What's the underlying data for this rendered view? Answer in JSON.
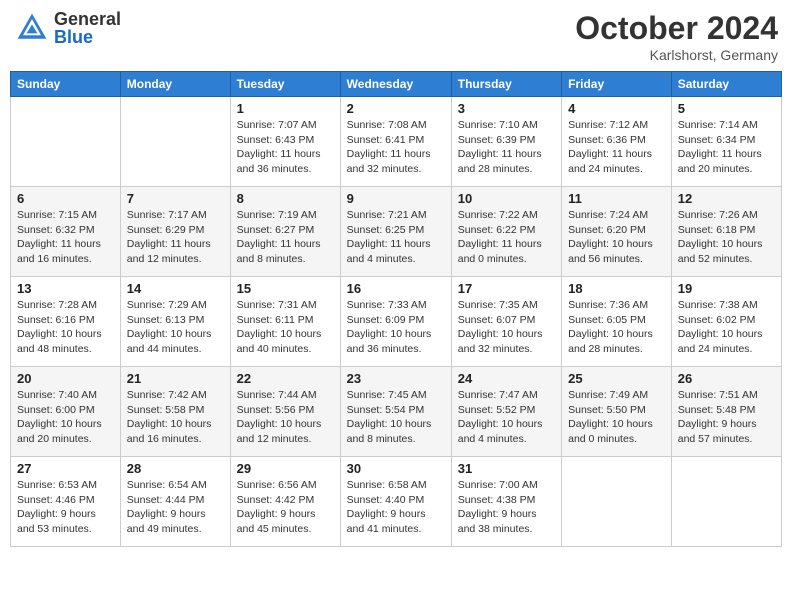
{
  "header": {
    "logo_general": "General",
    "logo_blue": "Blue",
    "month_title": "October 2024",
    "location": "Karlshorst, Germany"
  },
  "days_of_week": [
    "Sunday",
    "Monday",
    "Tuesday",
    "Wednesday",
    "Thursday",
    "Friday",
    "Saturday"
  ],
  "weeks": [
    [
      {
        "day": "",
        "info": ""
      },
      {
        "day": "",
        "info": ""
      },
      {
        "day": "1",
        "info": "Sunrise: 7:07 AM\nSunset: 6:43 PM\nDaylight: 11 hours and 36 minutes."
      },
      {
        "day": "2",
        "info": "Sunrise: 7:08 AM\nSunset: 6:41 PM\nDaylight: 11 hours and 32 minutes."
      },
      {
        "day": "3",
        "info": "Sunrise: 7:10 AM\nSunset: 6:39 PM\nDaylight: 11 hours and 28 minutes."
      },
      {
        "day": "4",
        "info": "Sunrise: 7:12 AM\nSunset: 6:36 PM\nDaylight: 11 hours and 24 minutes."
      },
      {
        "day": "5",
        "info": "Sunrise: 7:14 AM\nSunset: 6:34 PM\nDaylight: 11 hours and 20 minutes."
      }
    ],
    [
      {
        "day": "6",
        "info": "Sunrise: 7:15 AM\nSunset: 6:32 PM\nDaylight: 11 hours and 16 minutes."
      },
      {
        "day": "7",
        "info": "Sunrise: 7:17 AM\nSunset: 6:29 PM\nDaylight: 11 hours and 12 minutes."
      },
      {
        "day": "8",
        "info": "Sunrise: 7:19 AM\nSunset: 6:27 PM\nDaylight: 11 hours and 8 minutes."
      },
      {
        "day": "9",
        "info": "Sunrise: 7:21 AM\nSunset: 6:25 PM\nDaylight: 11 hours and 4 minutes."
      },
      {
        "day": "10",
        "info": "Sunrise: 7:22 AM\nSunset: 6:22 PM\nDaylight: 11 hours and 0 minutes."
      },
      {
        "day": "11",
        "info": "Sunrise: 7:24 AM\nSunset: 6:20 PM\nDaylight: 10 hours and 56 minutes."
      },
      {
        "day": "12",
        "info": "Sunrise: 7:26 AM\nSunset: 6:18 PM\nDaylight: 10 hours and 52 minutes."
      }
    ],
    [
      {
        "day": "13",
        "info": "Sunrise: 7:28 AM\nSunset: 6:16 PM\nDaylight: 10 hours and 48 minutes."
      },
      {
        "day": "14",
        "info": "Sunrise: 7:29 AM\nSunset: 6:13 PM\nDaylight: 10 hours and 44 minutes."
      },
      {
        "day": "15",
        "info": "Sunrise: 7:31 AM\nSunset: 6:11 PM\nDaylight: 10 hours and 40 minutes."
      },
      {
        "day": "16",
        "info": "Sunrise: 7:33 AM\nSunset: 6:09 PM\nDaylight: 10 hours and 36 minutes."
      },
      {
        "day": "17",
        "info": "Sunrise: 7:35 AM\nSunset: 6:07 PM\nDaylight: 10 hours and 32 minutes."
      },
      {
        "day": "18",
        "info": "Sunrise: 7:36 AM\nSunset: 6:05 PM\nDaylight: 10 hours and 28 minutes."
      },
      {
        "day": "19",
        "info": "Sunrise: 7:38 AM\nSunset: 6:02 PM\nDaylight: 10 hours and 24 minutes."
      }
    ],
    [
      {
        "day": "20",
        "info": "Sunrise: 7:40 AM\nSunset: 6:00 PM\nDaylight: 10 hours and 20 minutes."
      },
      {
        "day": "21",
        "info": "Sunrise: 7:42 AM\nSunset: 5:58 PM\nDaylight: 10 hours and 16 minutes."
      },
      {
        "day": "22",
        "info": "Sunrise: 7:44 AM\nSunset: 5:56 PM\nDaylight: 10 hours and 12 minutes."
      },
      {
        "day": "23",
        "info": "Sunrise: 7:45 AM\nSunset: 5:54 PM\nDaylight: 10 hours and 8 minutes."
      },
      {
        "day": "24",
        "info": "Sunrise: 7:47 AM\nSunset: 5:52 PM\nDaylight: 10 hours and 4 minutes."
      },
      {
        "day": "25",
        "info": "Sunrise: 7:49 AM\nSunset: 5:50 PM\nDaylight: 10 hours and 0 minutes."
      },
      {
        "day": "26",
        "info": "Sunrise: 7:51 AM\nSunset: 5:48 PM\nDaylight: 9 hours and 57 minutes."
      }
    ],
    [
      {
        "day": "27",
        "info": "Sunrise: 6:53 AM\nSunset: 4:46 PM\nDaylight: 9 hours and 53 minutes."
      },
      {
        "day": "28",
        "info": "Sunrise: 6:54 AM\nSunset: 4:44 PM\nDaylight: 9 hours and 49 minutes."
      },
      {
        "day": "29",
        "info": "Sunrise: 6:56 AM\nSunset: 4:42 PM\nDaylight: 9 hours and 45 minutes."
      },
      {
        "day": "30",
        "info": "Sunrise: 6:58 AM\nSunset: 4:40 PM\nDaylight: 9 hours and 41 minutes."
      },
      {
        "day": "31",
        "info": "Sunrise: 7:00 AM\nSunset: 4:38 PM\nDaylight: 9 hours and 38 minutes."
      },
      {
        "day": "",
        "info": ""
      },
      {
        "day": "",
        "info": ""
      }
    ]
  ]
}
